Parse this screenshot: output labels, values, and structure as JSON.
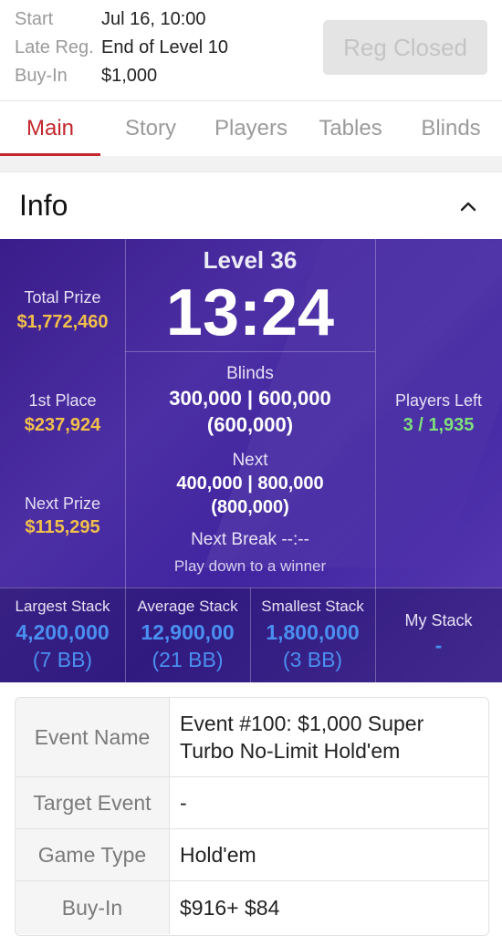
{
  "header": {
    "start_label": "Start",
    "start_value": "Jul 16, 10:00",
    "late_reg_label": "Late Reg.",
    "late_reg_value": "End of Level 10",
    "buyin_label": "Buy-In",
    "buyin_value": "$1,000",
    "reg_button": "Reg Closed"
  },
  "tabs": [
    {
      "label": "Main",
      "active": true
    },
    {
      "label": "Story"
    },
    {
      "label": "Players"
    },
    {
      "label": "Tables"
    },
    {
      "label": "Blinds"
    }
  ],
  "info": {
    "title": "Info",
    "collapse_icon": "chevron-up-icon"
  },
  "dashboard": {
    "level_label": "Level",
    "level_number": "36",
    "clock": "13:24",
    "total_prize_label": "Total Prize",
    "total_prize_value": "$1,772,460",
    "first_place_label": "1st Place",
    "first_place_value": "$237,924",
    "next_prize_label": "Next Prize",
    "next_prize_value": "$115,295",
    "blinds_label": "Blinds",
    "blinds_value": "300,000 | 600,000",
    "blinds_ante": "(600,000)",
    "next_label": "Next",
    "next_value": "400,000 | 800,000",
    "next_ante": "(800,000)",
    "next_break_label": "Next Break",
    "next_break_value": "--:--",
    "play_down": "Play down to a winner",
    "players_left_label": "Players Left",
    "players_left_value": "3 / 1,935",
    "largest_stack_label": "Largest Stack",
    "largest_stack_value": "4,200,000",
    "largest_stack_bb": "(7 BB)",
    "average_stack_label": "Average Stack",
    "average_stack_value": "12,900,00",
    "average_stack_bb": "(21 BB)",
    "smallest_stack_label": "Smallest Stack",
    "smallest_stack_value": "1,800,000",
    "smallest_stack_bb": "(3 BB)",
    "my_stack_label": "My Stack",
    "my_stack_value": "-"
  },
  "details": [
    {
      "key": "Event Name",
      "value_line1": "Event #100: $1,000 Super",
      "value_line2": "Turbo No-Limit Hold'em"
    },
    {
      "key": "Target Event",
      "value": "-"
    },
    {
      "key": "Game Type",
      "value": "Hold'em"
    },
    {
      "key": "Buy-In",
      "value": "$916+ $84"
    }
  ],
  "colors": {
    "accent": "#c3262d",
    "prize_gold": "#f2c04a",
    "players_green": "#7fe07a",
    "stack_blue": "#4a8ff0",
    "dashboard_purple": "#4527a0"
  }
}
